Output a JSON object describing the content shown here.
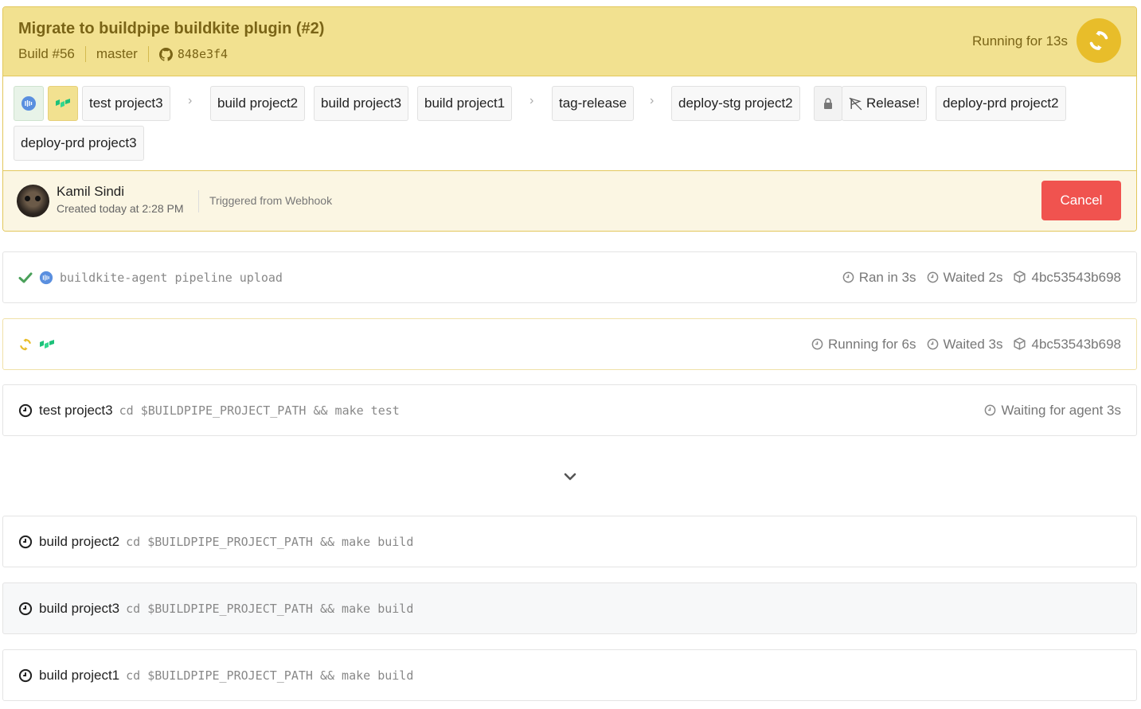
{
  "build": {
    "title": "Migrate to buildpipe buildkite plugin (#2)",
    "number": "Build #56",
    "branch": "master",
    "commit": "848e3f4",
    "running": "Running for 13s",
    "colors": {
      "header_bg": "#f2e190",
      "status": "#e8bd2a",
      "cancel": "#f0534f"
    }
  },
  "pipeline": {
    "steps": {
      "test3": "test project3",
      "build2": "build project2",
      "build3": "build project3",
      "build1": "build project1",
      "tag": "tag-release",
      "deploy_stg2": "deploy-stg project2",
      "release": "Release!",
      "deploy_prd2": "deploy-prd project2",
      "deploy_prd3": "deploy-prd project3"
    }
  },
  "creator": {
    "name": "Kamil Sindi",
    "created": "Created today at 2:28 PM",
    "trigger": "Triggered from Webhook",
    "cancel_label": "Cancel"
  },
  "jobs": [
    {
      "status": "passed",
      "command": "buildkite-agent pipeline upload",
      "ran": "Ran in 3s",
      "waited": "Waited 2s",
      "agent": "4bc53543b698"
    },
    {
      "status": "running",
      "running": "Running for 6s",
      "waited": "Waited 3s",
      "agent": "4bc53543b698"
    },
    {
      "status": "waiting",
      "label": "test project3",
      "command": "cd $BUILDPIPE_PROJECT_PATH && make test",
      "waiting": "Waiting for agent 3s"
    },
    {
      "status": "scheduled",
      "label": "build project2",
      "command": "cd $BUILDPIPE_PROJECT_PATH && make build"
    },
    {
      "status": "scheduled",
      "label": "build project3",
      "command": "cd $BUILDPIPE_PROJECT_PATH && make build"
    },
    {
      "status": "scheduled",
      "label": "build project1",
      "command": "cd $BUILDPIPE_PROJECT_PATH && make build"
    }
  ],
  "icons": {
    "buildkite_agent": "buildkite-agent-icon",
    "buildpipe": "buildpipe-plugin-icon",
    "clock": "clock-icon",
    "cube": "agent-cube-icon",
    "github": "github-icon"
  }
}
